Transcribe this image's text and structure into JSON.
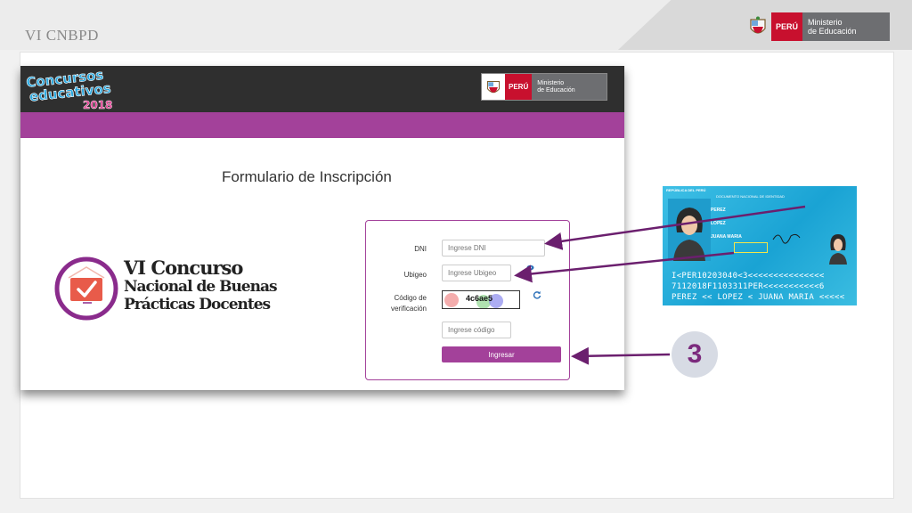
{
  "slide": {
    "title": "VI CNBPD"
  },
  "gov_logo": {
    "peru": "PERÚ",
    "line1": "Ministerio",
    "line2": "de Educación"
  },
  "app": {
    "brand_logo": {
      "line1": "Concursos",
      "line2": "educativos",
      "year": "2018"
    },
    "gov_logo": {
      "peru": "PERÚ",
      "line1": "Ministerio",
      "line2": "de Educación"
    },
    "form_title": "Formulario de Inscripción",
    "contest_logo": {
      "line1": "VI Concurso",
      "line2": "Nacional de Buenas",
      "line3": "Prácticas Docentes"
    },
    "form": {
      "dni_label": "DNI",
      "dni_placeholder": "Ingrese DNI",
      "ubigeo_label": "Ubigeo",
      "ubigeo_placeholder": "Ingrese Ubigeo",
      "code_label_1": "Código de",
      "code_label_2": "verificación",
      "captcha_text": "4c6ae5",
      "code_placeholder": "Ingrese código",
      "submit_label": "Ingresar"
    }
  },
  "dni_card": {
    "header": "REPÚBLICA DEL PERÚ",
    "doc_type": "DOCUMENTO NACIONAL DE IDENTIDAD",
    "surname1": "PEREZ",
    "surname2": "LOPEZ",
    "given_names": "JUANA MARIA",
    "mrz_line1": "I<PER10203040<3<<<<<<<<<<<<<<<",
    "mrz_line2": "7112018F1103311PER<<<<<<<<<<<6",
    "mrz_line3": "PEREZ << LOPEZ < JUANA MARIA <<<<<"
  },
  "step": {
    "number": "3"
  },
  "colors": {
    "accent": "#a3419a",
    "header_dark": "#2f2f2f",
    "peru_red": "#c8102e",
    "arrow": "#6b1f6e"
  }
}
